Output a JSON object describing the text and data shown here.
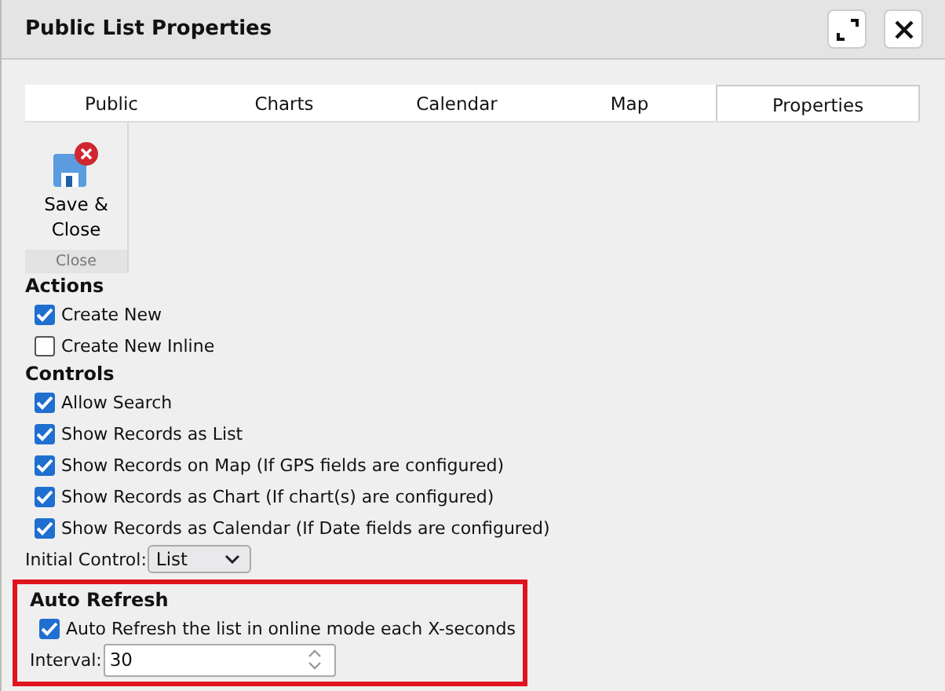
{
  "window": {
    "title": "Public List Properties"
  },
  "tabs": [
    {
      "label": "Public",
      "selected": false
    },
    {
      "label": "Charts",
      "selected": false
    },
    {
      "label": "Calendar",
      "selected": false
    },
    {
      "label": "Map",
      "selected": false
    },
    {
      "label": "Properties",
      "selected": true
    }
  ],
  "ribbon": {
    "button": "Save &\nClose",
    "group": "Close"
  },
  "sections": [
    {
      "title": "Actions",
      "highlighted": false,
      "items": [
        {
          "kind": "checkbox",
          "label": "Create New",
          "checked": true
        },
        {
          "kind": "checkbox",
          "label": "Create New Inline",
          "checked": false
        }
      ]
    },
    {
      "title": "Controls",
      "highlighted": false,
      "items": [
        {
          "kind": "checkbox",
          "label": "Allow Search",
          "checked": true
        },
        {
          "kind": "checkbox",
          "label": "Show Records as List",
          "checked": true
        },
        {
          "kind": "checkbox",
          "label": "Show Records on Map (If GPS fields are configured)",
          "checked": true
        },
        {
          "kind": "checkbox",
          "label": "Show Records as Chart (If chart(s) are configured)",
          "checked": true
        },
        {
          "kind": "checkbox",
          "label": "Show Records as Calendar (If Date fields are configured)",
          "checked": true
        },
        {
          "kind": "select",
          "label": "Initial Control:",
          "value": "List"
        }
      ]
    },
    {
      "title": "Auto Refresh",
      "highlighted": true,
      "items": [
        {
          "kind": "checkbox",
          "label": "Auto Refresh the list in online mode each X-seconds",
          "checked": true
        },
        {
          "kind": "number",
          "label": "Interval:",
          "value": "30"
        }
      ]
    }
  ]
}
